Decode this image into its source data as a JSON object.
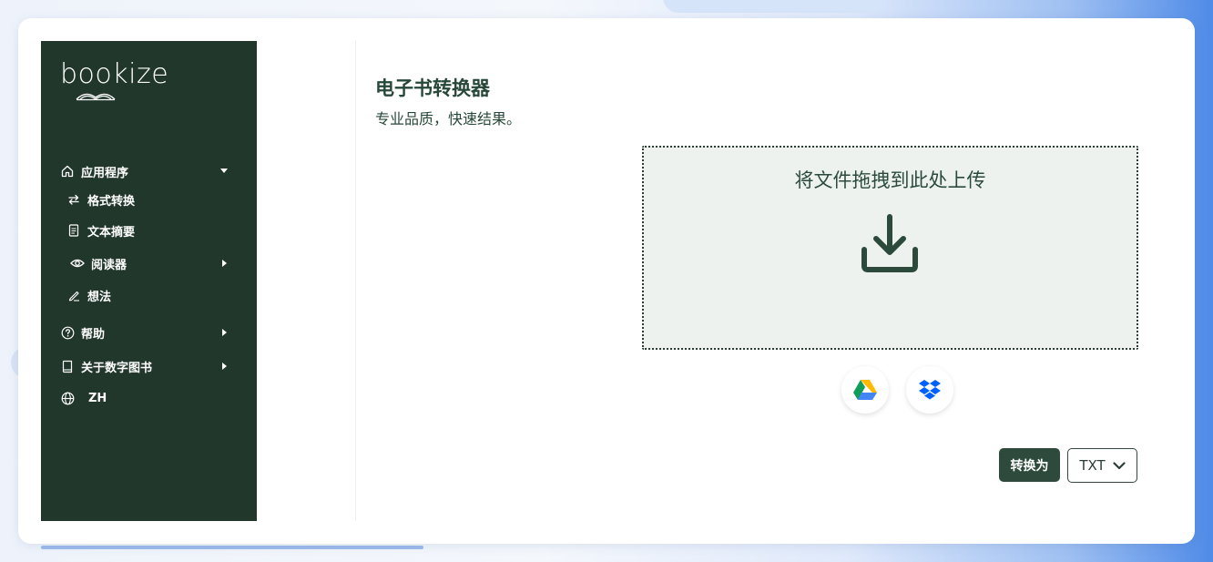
{
  "brand": {
    "logo_text": "bookize"
  },
  "sidebar": {
    "items": [
      {
        "label": "应用程序",
        "icon": "home-icon",
        "expandable": "down"
      },
      {
        "label": "格式转换",
        "icon": "swap-icon"
      },
      {
        "label": "文本摘要",
        "icon": "document-icon"
      },
      {
        "label": "阅读器",
        "icon": "eye-icon",
        "expandable": "right"
      },
      {
        "label": "想法",
        "icon": "pen-icon"
      },
      {
        "label": "帮助",
        "icon": "help-circle-icon",
        "expandable": "right"
      },
      {
        "label": "关于数字图书",
        "icon": "book-icon",
        "expandable": "right"
      },
      {
        "label": "ZH",
        "icon": "globe-icon"
      }
    ]
  },
  "main": {
    "title": "电子书转换器",
    "subtitle": "专业品质，快速结果。",
    "dropzone": {
      "text": "将文件拖拽到此处上传",
      "icon": "download-icon"
    },
    "cloud_buttons": [
      {
        "icon": "google-drive-icon"
      },
      {
        "icon": "dropbox-icon"
      }
    ],
    "convert_label": "转换为",
    "format_selected": "TXT"
  },
  "colors": {
    "sidebar_bg": "#21372c",
    "accent": "#2d4a3c",
    "dropzone_bg": "#edf2ef"
  }
}
